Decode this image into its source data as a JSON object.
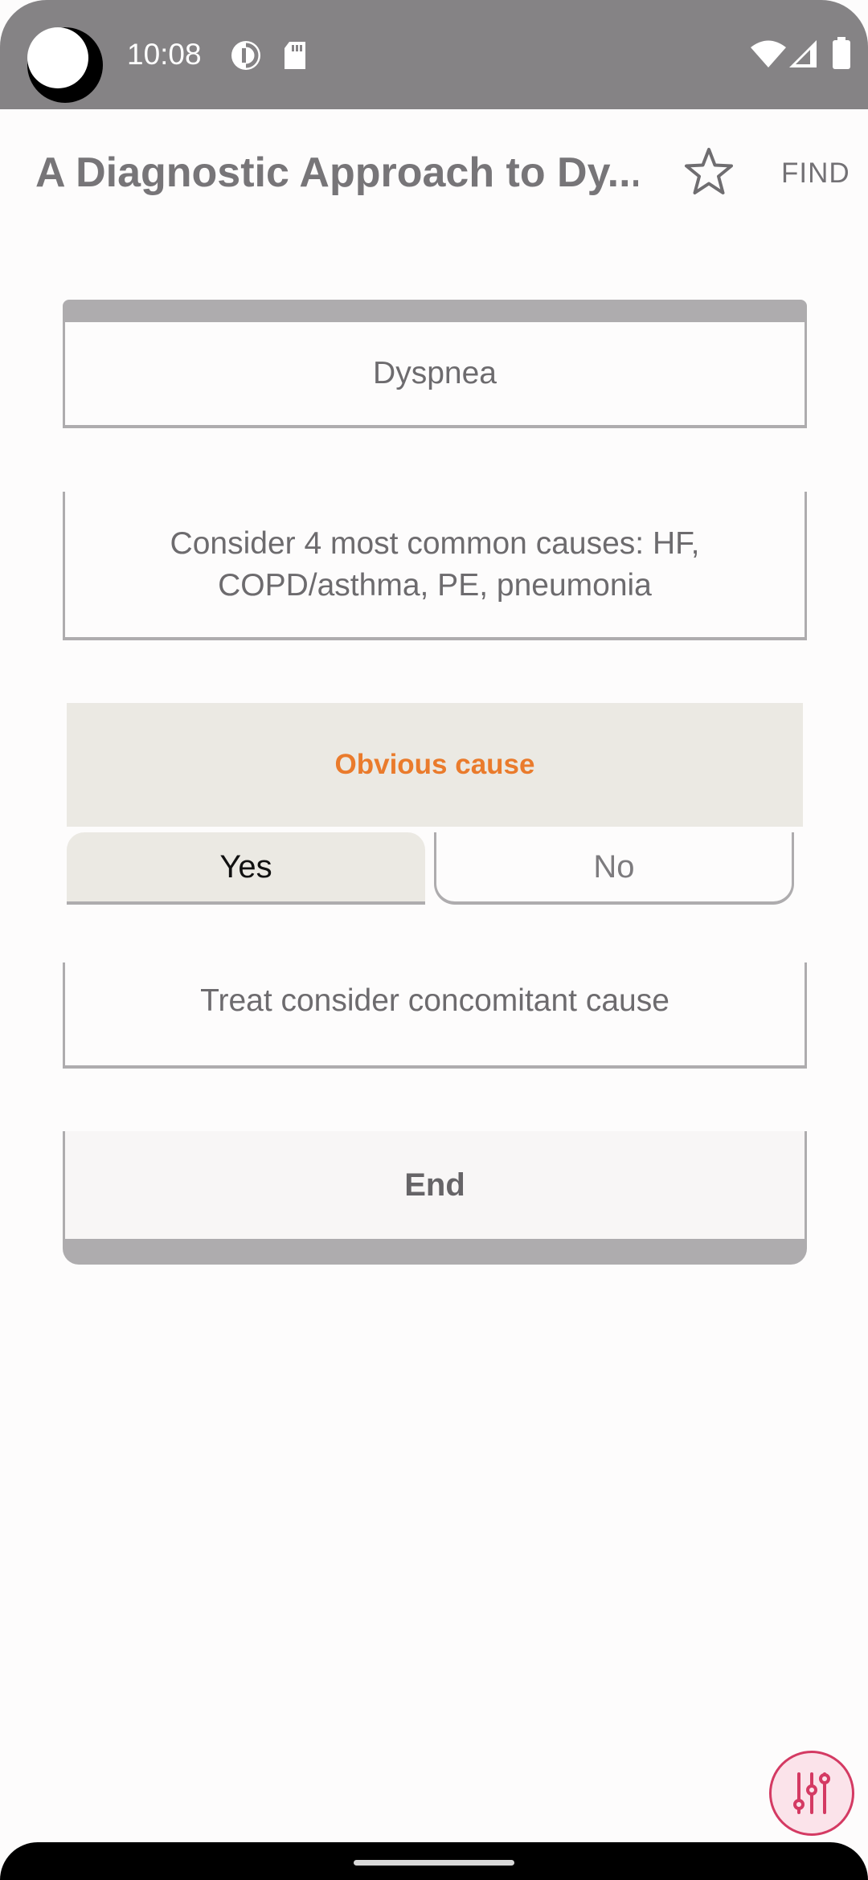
{
  "status_bar": {
    "time": "10:08",
    "icons": [
      "data-saver-icon",
      "sd-card-icon",
      "wifi-icon",
      "signal-icon",
      "battery-icon"
    ]
  },
  "app_bar": {
    "title": "A Diagnostic Approach to Dy...",
    "find_label": "FIND",
    "star_icon": "star-outline-icon"
  },
  "flowchart": {
    "start": "Dyspnea",
    "step_1": "Consider 4 most common causes: HF, COPD/asthma, PE, pneumonia",
    "question": "Obvious cause",
    "answers": {
      "yes": "Yes",
      "no": "No",
      "selected": "yes"
    },
    "step_2": "Treat consider concomitant cause",
    "end": "End"
  },
  "fab": {
    "icon": "sliders-icon"
  },
  "colors": {
    "status_bar": "#858385",
    "accent_orange": "#ea7b2c",
    "fab_accent": "#d43a63",
    "node_border": "#aeacae",
    "question_bg": "#ebe9e3"
  }
}
